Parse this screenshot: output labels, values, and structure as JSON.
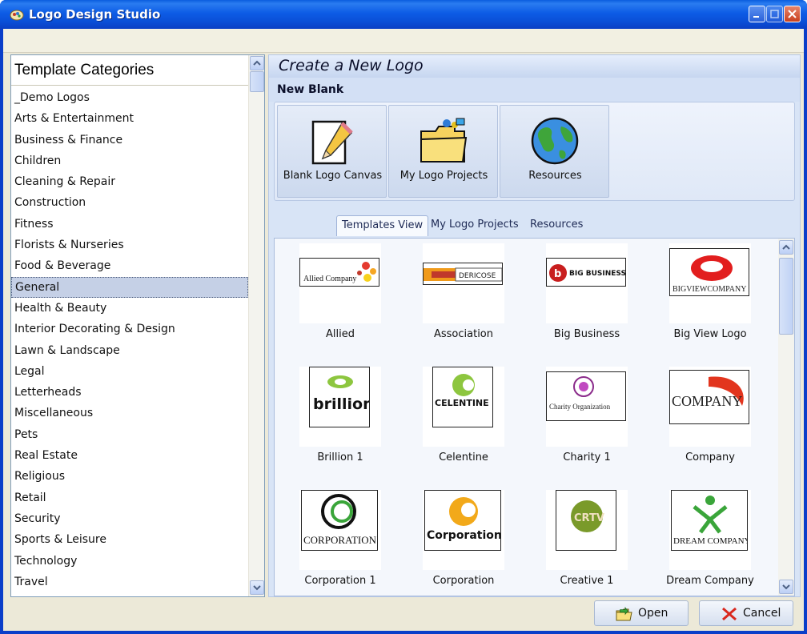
{
  "window": {
    "title": "Logo Design Studio"
  },
  "categories": {
    "header": "Template Categories",
    "selected": "General",
    "items": [
      "_Demo Logos",
      "Arts & Entertainment",
      "Business & Finance",
      "Children",
      "Cleaning & Repair",
      "Construction",
      "Fitness",
      "Florists & Nurseries",
      "Food & Beverage",
      "General",
      "Health & Beauty",
      "Interior Decorating & Design",
      "Lawn & Landscape",
      "Legal",
      "Letterheads",
      "Miscellaneous",
      "Pets",
      "Real Estate",
      "Religious",
      "Retail",
      "Security",
      "Sports & Leisure",
      "Technology",
      "Travel"
    ]
  },
  "create": {
    "heading": "Create a New Logo",
    "new_blank": "New Blank",
    "tiles": [
      {
        "label": "Blank Logo Canvas",
        "icon": "blank-canvas-pencil-icon"
      },
      {
        "label": "My Logo Projects",
        "icon": "folder-icon"
      },
      {
        "label": "Resources",
        "icon": "globe-icon"
      }
    ]
  },
  "tabs": [
    "Templates View",
    "My Logo Projects",
    "Resources"
  ],
  "active_tab": "Templates View",
  "templates": [
    {
      "label": "Allied",
      "logo_text": "Allied Company"
    },
    {
      "label": "Association",
      "logo_text": "DERICOSE"
    },
    {
      "label": "Big Business",
      "logo_text": "BIG BUSINESS"
    },
    {
      "label": "Big View Logo",
      "logo_text": "BIGVIEWCOMPANY"
    },
    {
      "label": "Brillion 1",
      "logo_text": "brillion"
    },
    {
      "label": "Celentine",
      "logo_text": "CELENTINE"
    },
    {
      "label": "Charity 1",
      "logo_text": "Charity Organization"
    },
    {
      "label": "Company",
      "logo_text": "COMPANY"
    },
    {
      "label": "Corporation 1",
      "logo_text": "CORPORATION"
    },
    {
      "label": "Corporation",
      "logo_text": "Corporation"
    },
    {
      "label": "Creative 1",
      "logo_text": "CRTV"
    },
    {
      "label": "Dream Company",
      "logo_text": "DREAM COMPANY"
    }
  ],
  "buttons": {
    "open": "Open",
    "cancel": "Cancel"
  }
}
